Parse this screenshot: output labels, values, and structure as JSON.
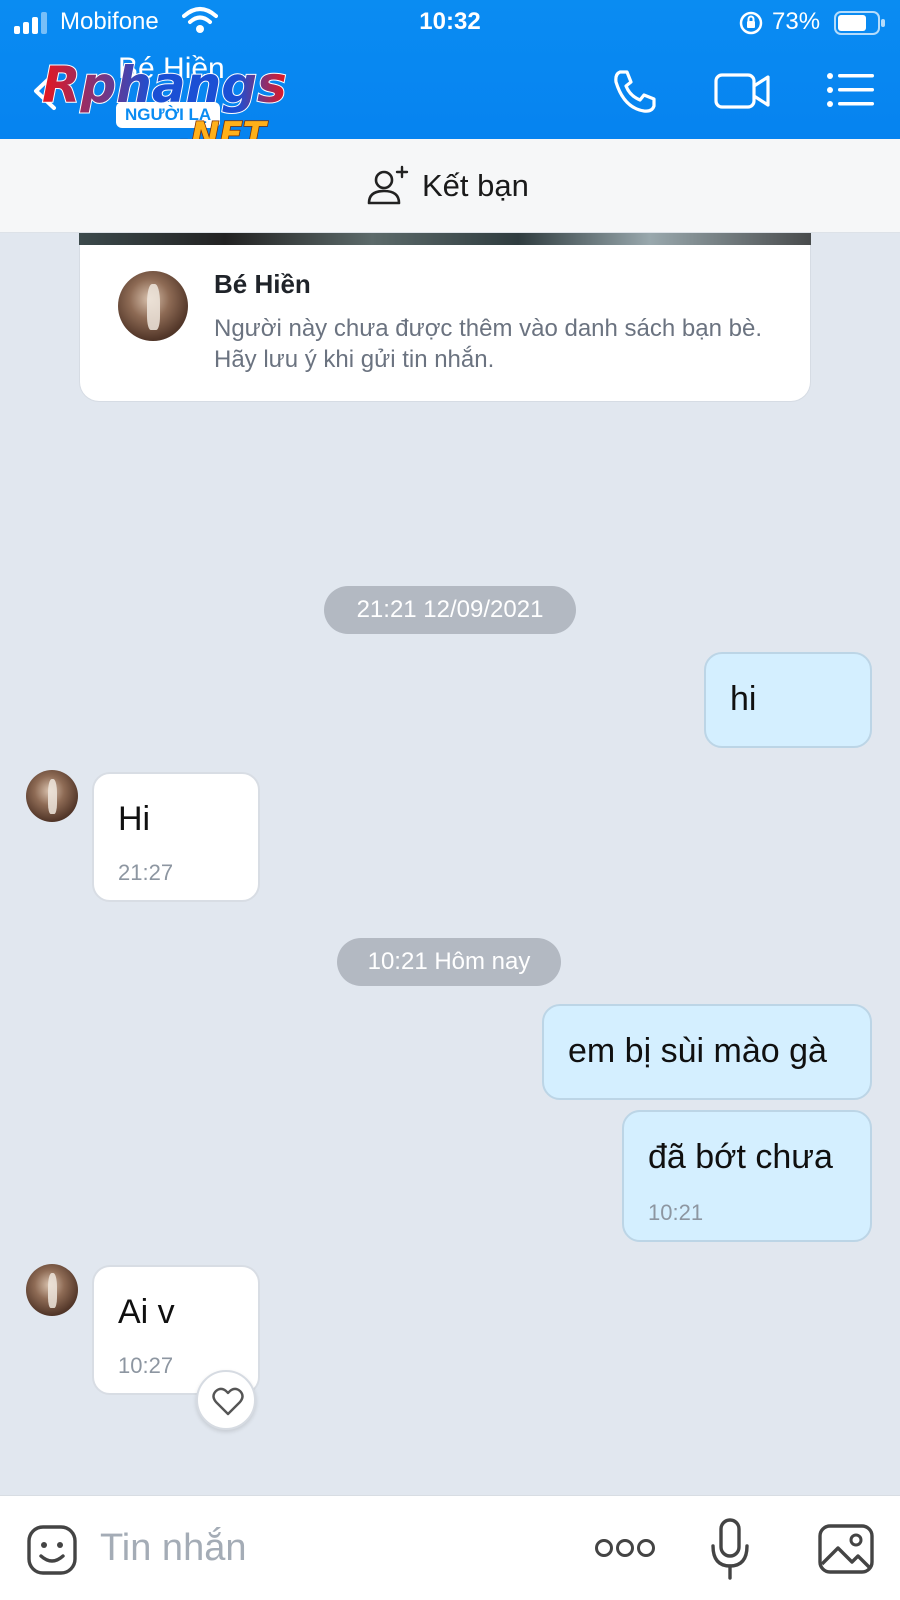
{
  "status_bar": {
    "carrier": "Mobifone",
    "time": "10:32",
    "battery": "73%"
  },
  "header": {
    "contact_name": "Bé Hiền",
    "stranger_tag": "NGƯỜI LẠ",
    "watermark": "Rphangs .NET",
    "icons": [
      "back-icon",
      "phone-icon",
      "video-icon",
      "menu-icon"
    ]
  },
  "add_friend": {
    "label": "Kết bạn",
    "icon": "add-friend-icon"
  },
  "profile_card": {
    "name": "Bé Hiền",
    "note": "Người này chưa được thêm vào danh sách bạn bè. Hãy lưu ý khi gửi tin nhắn."
  },
  "chat": {
    "separators": [
      "21:21 12/09/2021",
      "10:21 Hôm nay"
    ],
    "messages": [
      {
        "from": "me",
        "text": "hi"
      },
      {
        "from": "contact",
        "text": "Hi",
        "time": "21:27"
      },
      {
        "from": "me",
        "text": "em bị sùi mào gà"
      },
      {
        "from": "me",
        "text": "đã bớt chưa",
        "time": "10:21"
      },
      {
        "from": "contact",
        "text": "Ai v",
        "time": "10:27"
      }
    ]
  },
  "composer": {
    "placeholder": "Tin nhắn",
    "icons": [
      "sticker-icon",
      "more-icon",
      "microphone-icon",
      "image-icon"
    ]
  },
  "colors": {
    "header_blue": "#0a8cf2",
    "outgoing_bubble": "#d4efff",
    "chat_background": "#e1e7ef",
    "time_pill": "#b3b9c2"
  }
}
